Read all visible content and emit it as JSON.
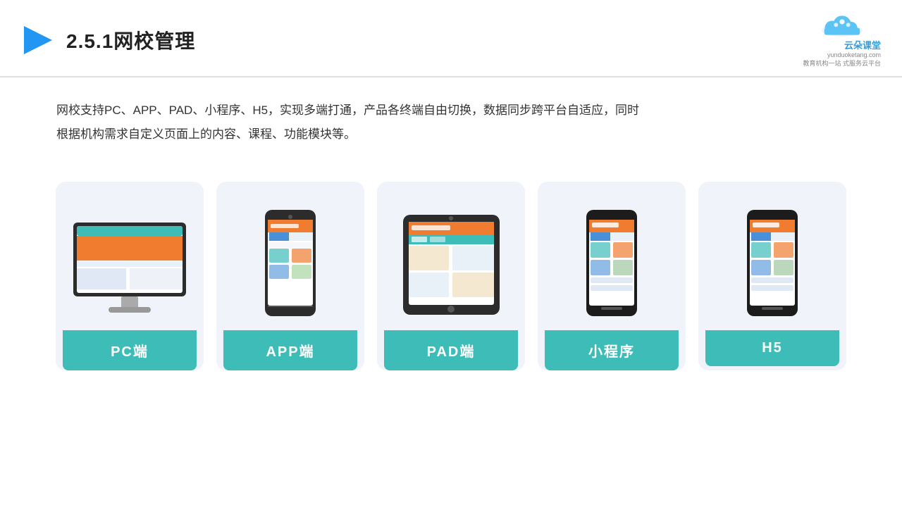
{
  "header": {
    "title": "2.5.1网校管理",
    "logo_main": "云朵课堂",
    "logo_url": "yunduoketang.com",
    "logo_tagline": "教育机构一站",
    "logo_tagline2": "式服务云平台"
  },
  "description": {
    "text": "网校支持PC、APP、PAD、小程序、H5，实现多端打通，产品各终端自由切换，数据同步跨平台自适应，同时根据机构需求自定义页面上的内容、课程、功能模块等。"
  },
  "cards": [
    {
      "id": "pc",
      "label": "PC端"
    },
    {
      "id": "app",
      "label": "APP端"
    },
    {
      "id": "pad",
      "label": "PAD端"
    },
    {
      "id": "miniapp",
      "label": "小程序"
    },
    {
      "id": "h5",
      "label": "H5"
    }
  ]
}
